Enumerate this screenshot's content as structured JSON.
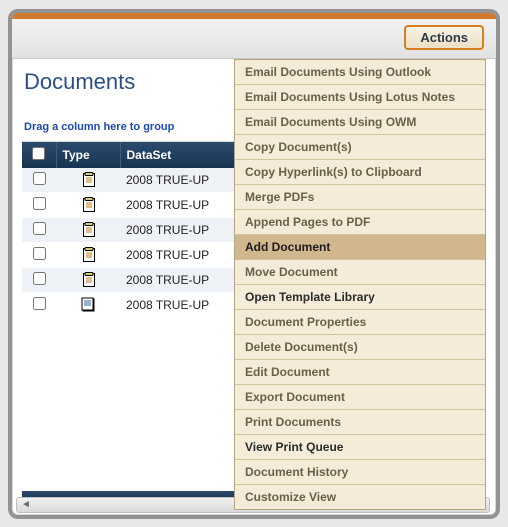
{
  "page_title": "Documents",
  "group_hint": "Drag a column here to group",
  "actions_label": "Actions",
  "columns": {
    "type": "Type",
    "dataset": "DataSet"
  },
  "rows": [
    {
      "dataset": "2008 TRUE-UP",
      "icon": "form"
    },
    {
      "dataset": "2008 TRUE-UP",
      "icon": "form"
    },
    {
      "dataset": "2008 TRUE-UP",
      "icon": "form"
    },
    {
      "dataset": "2008 TRUE-UP",
      "icon": "form"
    },
    {
      "dataset": "2008 TRUE-UP",
      "icon": "form"
    },
    {
      "dataset": "2008 TRUE-UP",
      "icon": "note"
    }
  ],
  "menu": [
    {
      "label": "Email Documents Using Outlook",
      "enabled": false
    },
    {
      "label": "Email Documents Using Lotus Notes",
      "enabled": false
    },
    {
      "label": "Email Documents Using OWM",
      "enabled": false
    },
    {
      "label": "Copy Document(s)",
      "enabled": false
    },
    {
      "label": "Copy Hyperlink(s) to Clipboard",
      "enabled": false
    },
    {
      "label": "Merge PDFs",
      "enabled": false
    },
    {
      "label": "Append Pages to PDF",
      "enabled": false
    },
    {
      "label": "Add Document",
      "enabled": true,
      "hover": true
    },
    {
      "label": "Move Document",
      "enabled": false
    },
    {
      "label": "Open Template Library",
      "enabled": true
    },
    {
      "label": "Document Properties",
      "enabled": false
    },
    {
      "label": "Delete Document(s)",
      "enabled": false
    },
    {
      "label": "Edit Document",
      "enabled": false
    },
    {
      "label": "Export Document",
      "enabled": false
    },
    {
      "label": "Print Documents",
      "enabled": false
    },
    {
      "label": "View Print Queue",
      "enabled": true
    },
    {
      "label": "Document History",
      "enabled": false
    },
    {
      "label": "Customize View",
      "enabled": false
    }
  ]
}
